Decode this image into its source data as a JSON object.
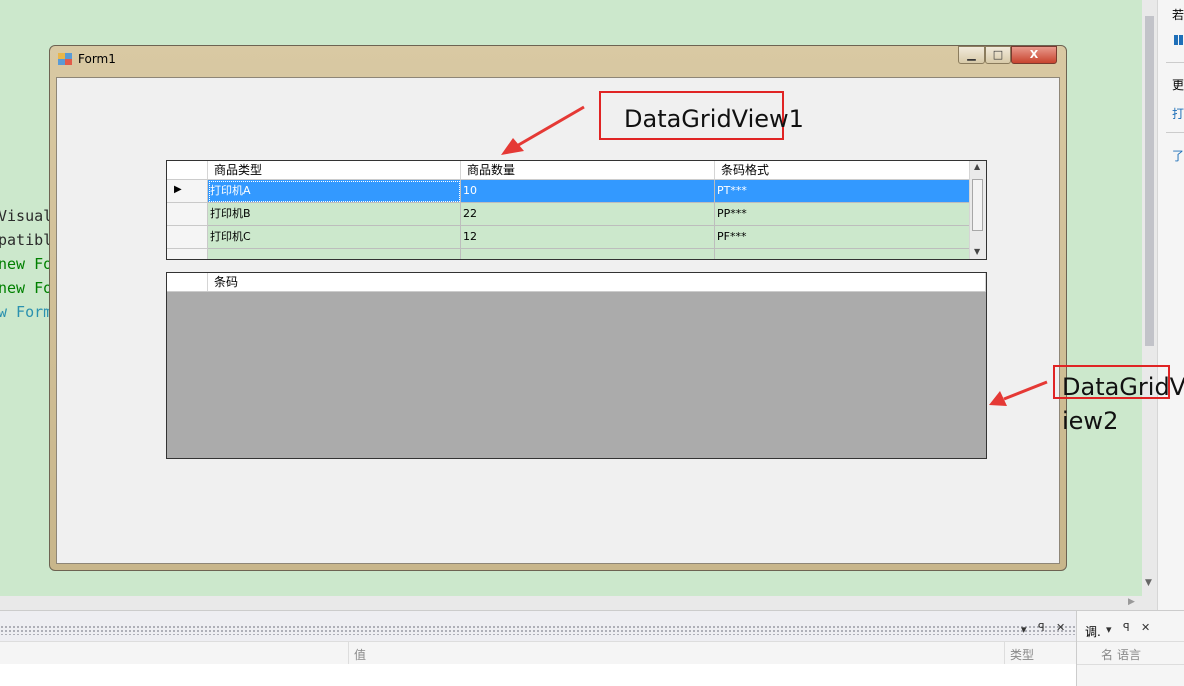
{
  "editor": {
    "code_lines": [
      {
        "text": "Visual",
        "color": "#2b2b2b"
      },
      {
        "text": "patibl",
        "color": "#2b2b2b"
      },
      {
        "text": "new Fo",
        "color": "#008000"
      },
      {
        "text": "new Fo",
        "color": "#008000"
      },
      {
        "text": "w Form",
        "color": "#2b91af"
      }
    ]
  },
  "right_panel": {
    "items": [
      "若",
      "更",
      "打",
      "了"
    ]
  },
  "window": {
    "title": "Form1",
    "buttons": {
      "minimize": "▁",
      "maximize": "□",
      "close": "X"
    }
  },
  "grid1": {
    "columns": [
      "商品类型",
      "商品数量",
      "条码格式"
    ],
    "rows": [
      {
        "cells": [
          "打印机A",
          "10",
          "PT***"
        ],
        "selected": true
      },
      {
        "cells": [
          "打印机B",
          "22",
          "PP***"
        ],
        "selected": false
      },
      {
        "cells": [
          "打印机C",
          "12",
          "PF***"
        ],
        "selected": false
      }
    ]
  },
  "grid2": {
    "columns": [
      "条码"
    ],
    "rows": []
  },
  "annotations": {
    "label1": "DataGridView1",
    "label2_line1": "DataGridV",
    "label2_line2": "iew2",
    "arrow_color": "#e53935"
  },
  "bottom_panel": {
    "properties_value_header": "值",
    "properties_type_header": "类型",
    "tab_label": "调.",
    "right_header_a": "名",
    "right_header_b": "语言"
  }
}
